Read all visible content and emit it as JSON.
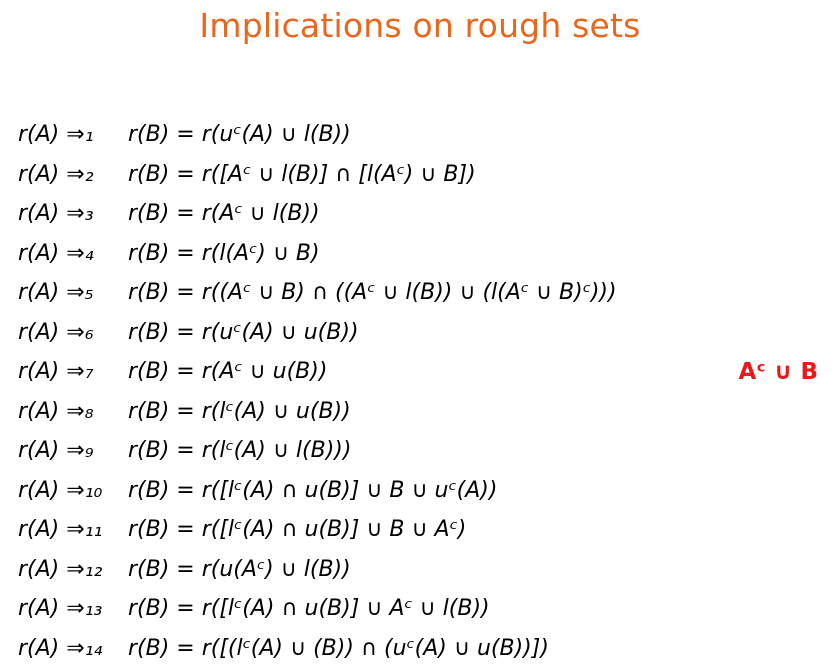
{
  "title": "Implications on rough sets",
  "colors": {
    "title": "#e8671d",
    "annotation": "#e8191b",
    "text": "#000000"
  },
  "formulas": [
    {
      "lhs": "r(A) ⇒₁",
      "rhs": "r(B) = r(uᶜ(A) ∪ l(B))"
    },
    {
      "lhs": "r(A) ⇒₂",
      "rhs": "r(B) = r([Aᶜ ∪ l(B)] ∩ [l(Aᶜ) ∪ B])"
    },
    {
      "lhs": "r(A) ⇒₃",
      "rhs": "r(B) = r(Aᶜ ∪ l(B))"
    },
    {
      "lhs": "r(A) ⇒₄",
      "rhs": "r(B) = r(l(Aᶜ) ∪ B)"
    },
    {
      "lhs": "r(A) ⇒₅",
      "rhs": "r(B) = r((Aᶜ ∪ B) ∩ ((Aᶜ ∪ l(B)) ∪ (l(Aᶜ ∪ B)ᶜ)))"
    },
    {
      "lhs": "r(A) ⇒₆",
      "rhs": "r(B) = r(uᶜ(A) ∪ u(B))"
    },
    {
      "lhs": "r(A) ⇒₇",
      "rhs": "r(B) = r(Aᶜ ∪ u(B))",
      "annotation": "Aᶜ ∪ B"
    },
    {
      "lhs": "r(A) ⇒₈",
      "rhs": "r(B) = r(lᶜ(A) ∪ u(B))"
    },
    {
      "lhs": "r(A) ⇒₉",
      "rhs": "r(B) = r(lᶜ(A) ∪ l(B)))"
    },
    {
      "lhs": "r(A) ⇒₁₀",
      "rhs": "r(B) = r([lᶜ(A) ∩ u(B)] ∪ B ∪ uᶜ(A))"
    },
    {
      "lhs": "r(A) ⇒₁₁",
      "rhs": "r(B) = r([lᶜ(A) ∩ u(B)] ∪ B ∪ Aᶜ)"
    },
    {
      "lhs": "r(A) ⇒₁₂",
      "rhs": "r(B) = r(u(Aᶜ) ∪ l(B))"
    },
    {
      "lhs": "r(A) ⇒₁₃",
      "rhs": "r(B) = r([lᶜ(A) ∩ u(B)] ∪ Aᶜ ∪ l(B))"
    },
    {
      "lhs": "r(A) ⇒₁₄",
      "rhs": "r(B) = r([(lᶜ(A) ∪ (B)) ∩ (uᶜ(A) ∪ u(B))])"
    }
  ]
}
